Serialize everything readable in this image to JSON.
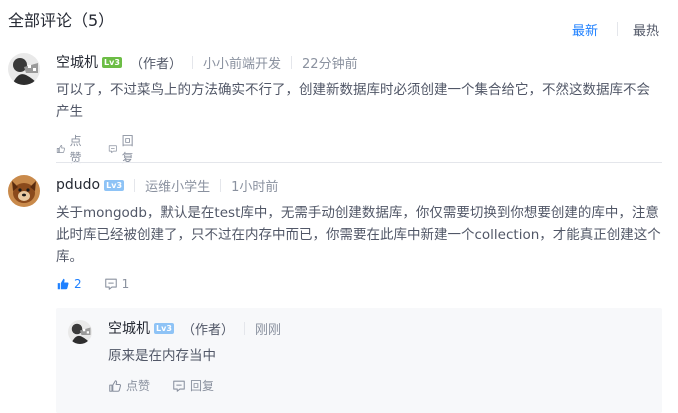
{
  "header": {
    "title": "全部评论（5）",
    "sort_new": "最新",
    "sort_hot": "最热"
  },
  "comments": [
    {
      "user": "空城机",
      "level": "Lv3",
      "author_tag": "（作者）",
      "job": "小小前端开发",
      "time": "22分钟前",
      "text": "可以了，不过菜鸟上的方法确实不行了，创建新数据库时必须创建一个集合给它，不然这数据库不会产生",
      "like_label": "点赞",
      "reply_label": "回复"
    },
    {
      "user": "pdudo",
      "level": "Lv3",
      "job": "运维小学生",
      "time": "1小时前",
      "text": "关于mongodb，默认是在test库中，无需手动创建数据库，你仅需要切换到你想要创建的库中，注意此时库已经被创建了，只不过在内存中而已，你需要在此库中新建一个collection，才能真正创建这个库。",
      "like_count": "2",
      "reply_count": "1"
    }
  ],
  "reply": {
    "user": "空城机",
    "level": "Lv3",
    "author_tag": "（作者）",
    "time": "刚刚",
    "text": "原来是在内存当中",
    "like_label": "点赞",
    "reply_label": "回复"
  },
  "colors": {
    "accent": "#1e80ff",
    "text_primary": "#252933",
    "text_secondary": "#515767",
    "text_muted": "#8a919f",
    "level_badge_green": "#6cbd45",
    "level_badge_blue": "#8ec3f6"
  }
}
